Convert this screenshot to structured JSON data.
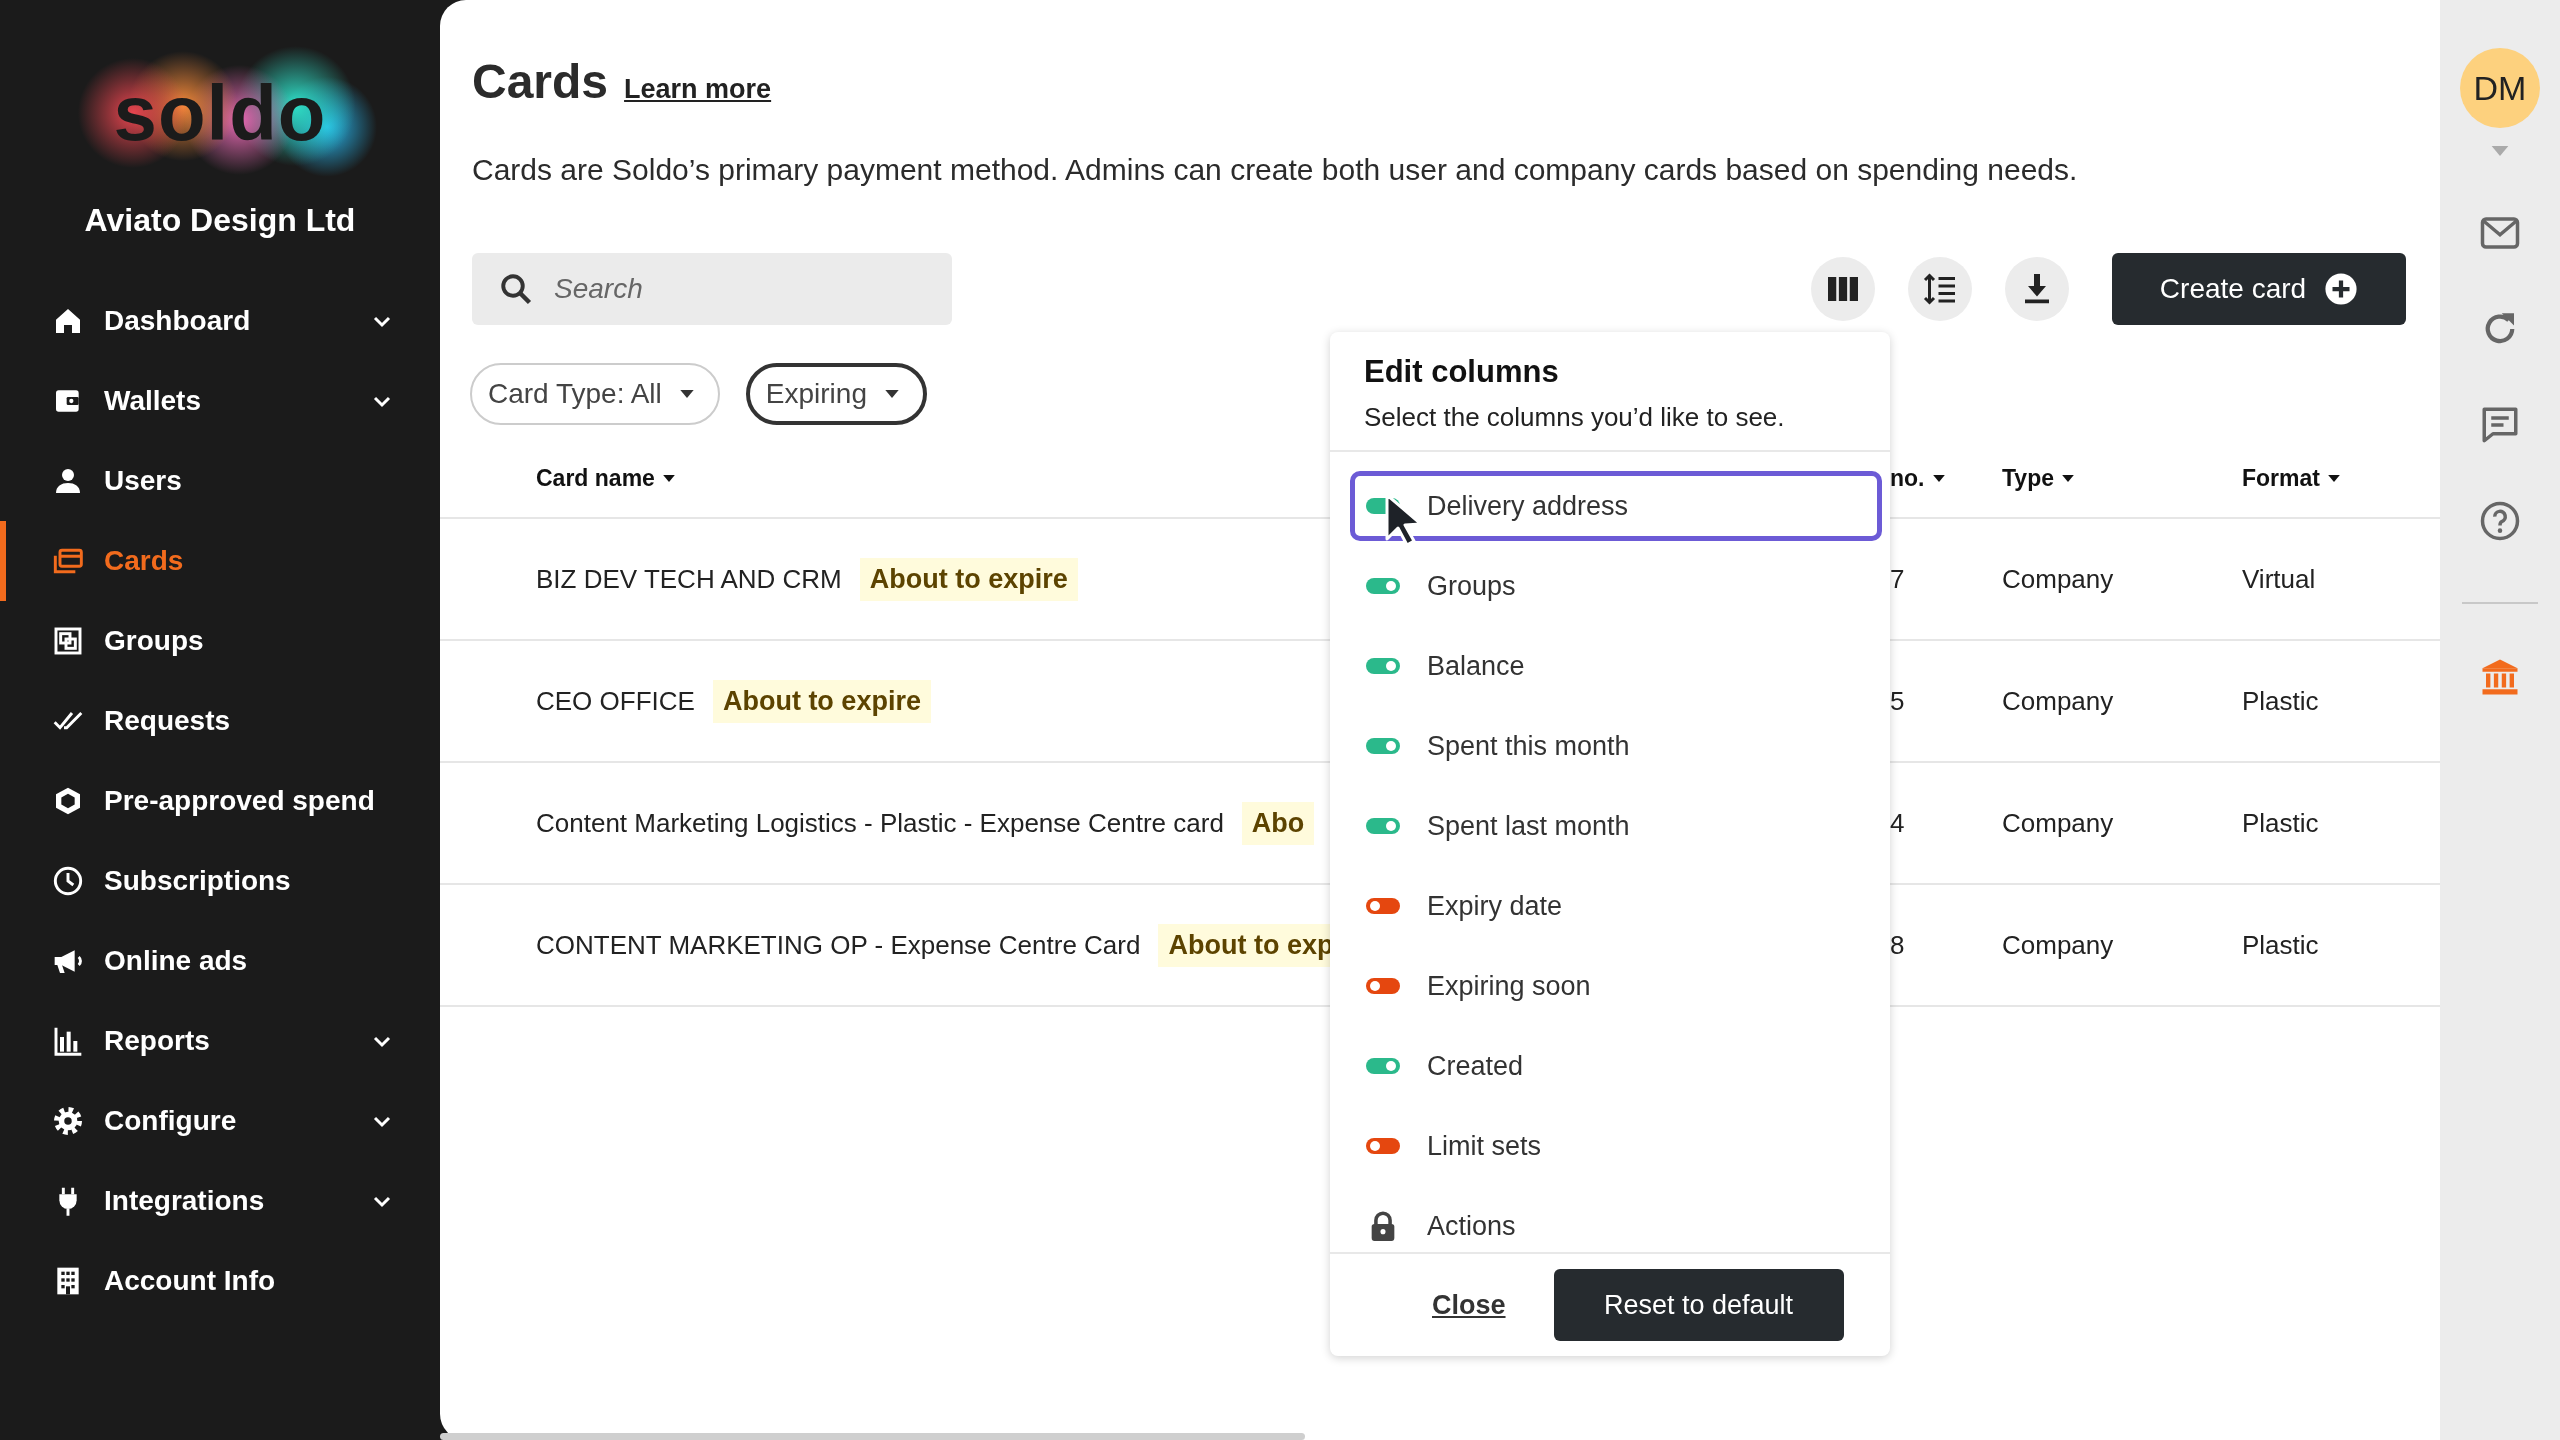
{
  "sidebar": {
    "logo": "soldo",
    "company": "Aviato Design Ltd",
    "items": [
      {
        "label": "Dashboard",
        "expandable": true,
        "selected": false
      },
      {
        "label": "Wallets",
        "expandable": true,
        "selected": false
      },
      {
        "label": "Users",
        "expandable": false,
        "selected": false
      },
      {
        "label": "Cards",
        "expandable": false,
        "selected": true
      },
      {
        "label": "Groups",
        "expandable": false,
        "selected": false
      },
      {
        "label": "Requests",
        "expandable": false,
        "selected": false
      },
      {
        "label": "Pre-approved spend",
        "expandable": false,
        "selected": false
      },
      {
        "label": "Subscriptions",
        "expandable": false,
        "selected": false
      },
      {
        "label": "Online ads",
        "expandable": false,
        "selected": false
      },
      {
        "label": "Reports",
        "expandable": true,
        "selected": false
      },
      {
        "label": "Configure",
        "expandable": true,
        "selected": false
      },
      {
        "label": "Integrations",
        "expandable": true,
        "selected": false
      },
      {
        "label": "Account Info",
        "expandable": false,
        "selected": false
      }
    ]
  },
  "header": {
    "title": "Cards",
    "link": "Learn more",
    "description": "Cards are Soldo’s primary payment method. Admins can create both user and company cards based on spending needs."
  },
  "toolbar": {
    "search": {
      "placeholder": "Search"
    },
    "create_button": "Create card"
  },
  "filters": [
    {
      "label": "Card Type: All",
      "active": false
    },
    {
      "label": "Expiring",
      "active": true
    }
  ],
  "table": {
    "columns": [
      {
        "label": "Card name"
      },
      {
        "label": "no."
      },
      {
        "label": "Type"
      },
      {
        "label": "Format"
      }
    ],
    "rows": [
      {
        "name": "BIZ DEV TECH AND CRM",
        "badge": "About to expire",
        "column_2": "7",
        "type": "Company",
        "format": "Virtual"
      },
      {
        "name": "CEO OFFICE",
        "badge": "About to expire",
        "column_2": "5",
        "type": "Company",
        "format": "Plastic"
      },
      {
        "name": "Content Marketing Logistics - Plastic - Expense Centre card",
        "badge": "Abo",
        "column_2": "4",
        "type": "Company",
        "format": "Plastic"
      },
      {
        "name": "CONTENT MARKETING OP - Expense Centre Card",
        "badge": "About to exp",
        "column_2": "8",
        "type": "Company",
        "format": "Plastic"
      }
    ]
  },
  "edit_columns": {
    "title": "Edit columns",
    "subtitle": "Select the columns you’d like to see.",
    "items": [
      {
        "label": "Delivery address",
        "kind": "toggle",
        "on": true,
        "focused": true
      },
      {
        "label": "Groups",
        "kind": "toggle",
        "on": true,
        "focused": false
      },
      {
        "label": "Balance",
        "kind": "toggle",
        "on": true,
        "focused": false
      },
      {
        "label": "Spent this month",
        "kind": "toggle",
        "on": true,
        "focused": false
      },
      {
        "label": "Spent last month",
        "kind": "toggle",
        "on": true,
        "focused": false
      },
      {
        "label": "Expiry date",
        "kind": "toggle",
        "on": false,
        "focused": false
      },
      {
        "label": "Expiring soon",
        "kind": "toggle",
        "on": false,
        "focused": false
      },
      {
        "label": "Created",
        "kind": "toggle",
        "on": true,
        "focused": false
      },
      {
        "label": "Limit sets",
        "kind": "toggle",
        "on": false,
        "focused": false
      },
      {
        "label": "Actions",
        "kind": "locked",
        "focused": false
      }
    ],
    "close": "Close",
    "reset": "Reset to default"
  },
  "user": {
    "initials": "DM"
  }
}
